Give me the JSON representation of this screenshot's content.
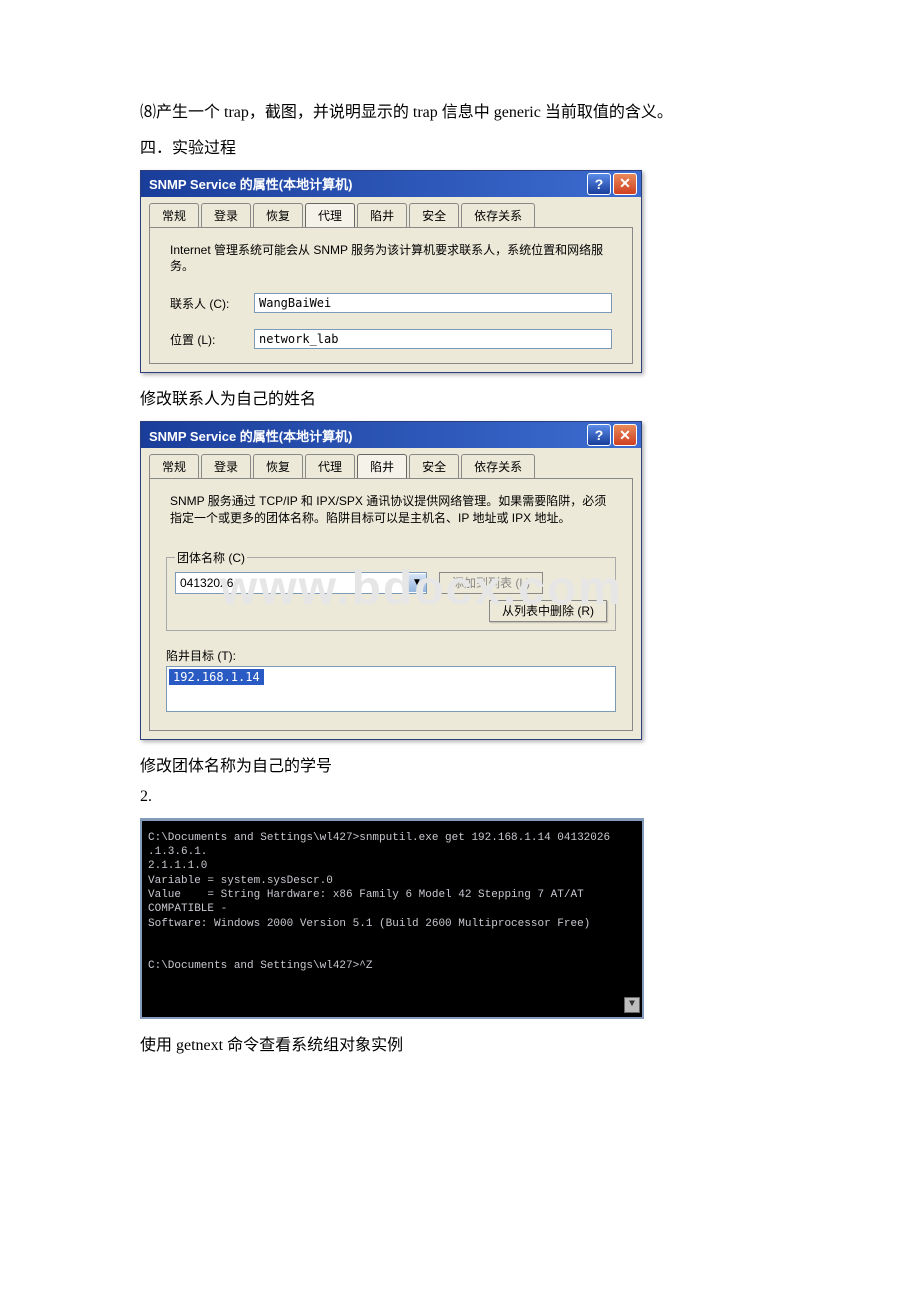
{
  "question8": "⑻产生一个 trap，截图，并说明显示的 trap 信息中 generic 当前取值的含义。",
  "section4": "四．实验过程",
  "dialog1": {
    "title": "SNMP Service 的属性(本地计算机)",
    "tabs": [
      "常规",
      "登录",
      "恢复",
      "代理",
      "陷井",
      "安全",
      "依存关系"
    ],
    "active_tab": "代理",
    "desc": "Internet 管理系统可能会从 SNMP 服务为该计算机要求联系人，系统位置和网络服务。",
    "contact_label": "联系人 (C):",
    "contact_value": "WangBaiWei",
    "location_label": "位置 (L):",
    "location_value": "network_lab"
  },
  "caption1": "修改联系人为自己的姓名",
  "dialog2": {
    "title": "SNMP Service 的属性(本地计算机)",
    "tabs": [
      "常规",
      "登录",
      "恢复",
      "代理",
      "陷井",
      "安全",
      "依存关系"
    ],
    "active_tab": "陷井",
    "desc": "SNMP 服务通过 TCP/IP 和 IPX/SPX 通讯协议提供网络管理。如果需要陷阱，必须指定一个或更多的团体名称。陷阱目标可以是主机名、IP 地址或 IPX 地址。",
    "community_label": "团体名称 (C)",
    "community_value": "04132026",
    "add_btn": "添加到列表 (L)",
    "remove_btn": "从列表中删除 (R)",
    "target_label": "陷井目标 (T):",
    "target_value": "192.168.1.14"
  },
  "watermark": "www.bdocx.com",
  "caption2": "修改团体名称为自己的学号",
  "step2": "2.",
  "terminal": {
    "line1": "C:\\Documents and Settings\\wl427>snmputil.exe get 192.168.1.14 04132026 .1.3.6.1.",
    "line2": "2.1.1.1.0",
    "line3": "Variable = system.sysDescr.0",
    "line4": "Value    = String Hardware: x86 Family 6 Model 42 Stepping 7 AT/AT COMPATIBLE -",
    "line5": "Software: Windows 2000 Version 5.1 (Build 2600 Multiprocessor Free)",
    "line6": "C:\\Documents and Settings\\wl427>^Z"
  },
  "caption3": "使用 getnext 命令查看系统组对象实例"
}
